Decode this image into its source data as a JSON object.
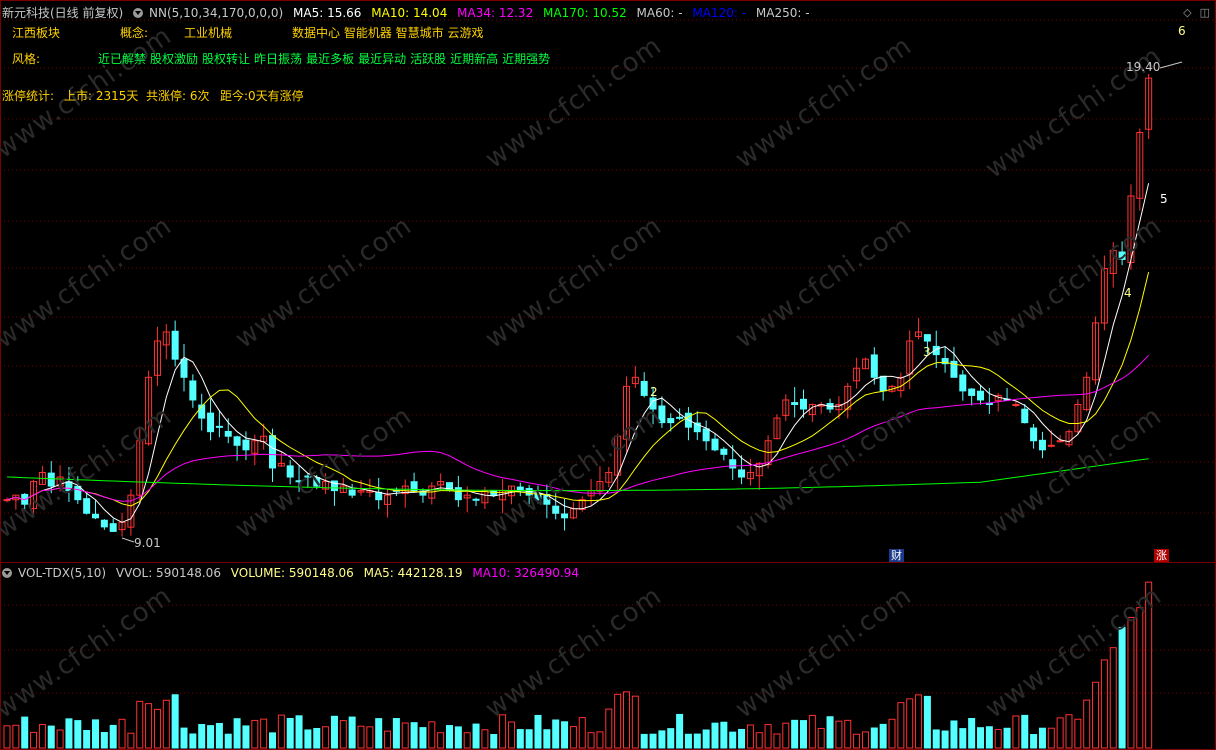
{
  "main_header": {
    "title": "新元科技(日线 前复权)",
    "indicator": "NN(5,10,34,170,0,0,0)",
    "ma5": "MA5: 15.66",
    "ma10": "MA10: 14.04",
    "ma34": "MA34: 12.32",
    "ma170": "MA170: 10.52",
    "ma60": "MA60: -",
    "ma120": "MA120: -",
    "ma250": "MA250: -"
  },
  "info": {
    "sector_label": "江西板块",
    "concept_label": "概念:",
    "concept_value": "工业机械",
    "concepts_more": "数据中心 智能机器 智慧城市 云游戏",
    "style_label": "风格:",
    "style_items": [
      "近已解禁",
      "股权激励",
      "股权转让",
      "昨日振荡",
      "最近多板",
      "最近异动",
      "活跃股",
      "近期新高",
      "近期强势"
    ],
    "limit_label": "涨停统计:",
    "listed": "上市: 2315天",
    "total_limit": "共涨停: 6次",
    "since": "距今:0天有涨停"
  },
  "annotations": {
    "high_price": "19.40",
    "low_price": "9.01",
    "count_2": "2",
    "count_3": "3",
    "count_4": "4",
    "count_5": "5",
    "count_6": "6",
    "badge_cai": "财",
    "badge_zhang": "涨"
  },
  "vol_header": {
    "indicator": "VOL-TDX(5,10)",
    "vvol": "VVOL: 590148.06",
    "volume": "VOLUME: 590148.06",
    "ma5": "MA5: 442128.19",
    "ma10": "MA10: 326490.94"
  },
  "watermark": "www.cfchi.com",
  "colors": {
    "up": "#ff3232",
    "down": "#54ffff",
    "ma5": "#ffffff",
    "ma10": "#ffff00",
    "ma34": "#ff00ff",
    "ma170": "#00ff00",
    "grid": "#7a0000",
    "label_yellow": "#ffd200",
    "label_green": "#00ff40"
  }
}
